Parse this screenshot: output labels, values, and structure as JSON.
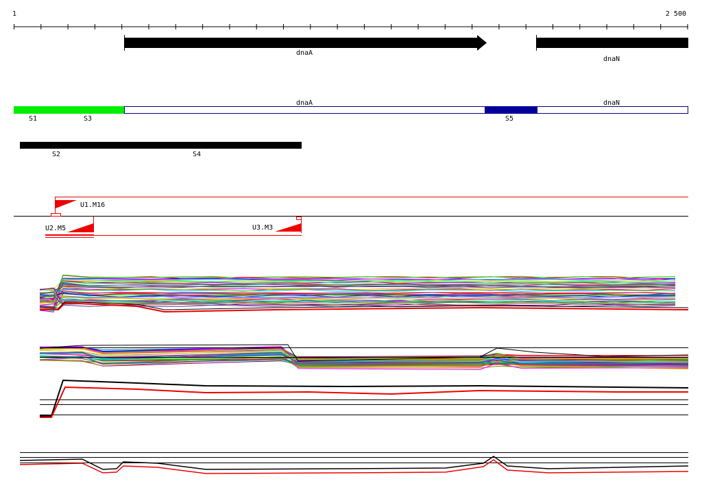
{
  "ruler": {
    "start_label": "1",
    "end_label": "2 500"
  },
  "genes": [
    {
      "id": "gene-dnaA",
      "label": "dnaA"
    },
    {
      "id": "gene-dnaN",
      "label": "dnaN"
    }
  ],
  "regions": [
    {
      "id": "region-dnaA",
      "label": "dnaA"
    },
    {
      "id": "region-dnaN",
      "label": "dnaN"
    }
  ],
  "region_markers": [
    {
      "id": "marker-s1",
      "label": "S1"
    },
    {
      "id": "marker-s3",
      "label": "S3"
    },
    {
      "id": "marker-s5",
      "label": "S5"
    }
  ],
  "segments": [
    {
      "id": "marker-s2",
      "label": "S2"
    },
    {
      "id": "marker-s4",
      "label": "S4"
    }
  ],
  "primers": [
    {
      "id": "primer-u1-m16",
      "label": "U1.M16"
    },
    {
      "id": "primer-u2-m5",
      "label": "U2.M5"
    },
    {
      "id": "primer-u3-m3",
      "label": "U3.M3"
    }
  ],
  "colors": {
    "green_region": "#00ee00",
    "navy_region": "#000099",
    "outline_blue": "#000080",
    "primer_red": "#ee0000",
    "gene_black": "#000000"
  },
  "icons": {
    "gene_arrow": "arrow-right-icon",
    "primer_flag": "flag-icon"
  }
}
